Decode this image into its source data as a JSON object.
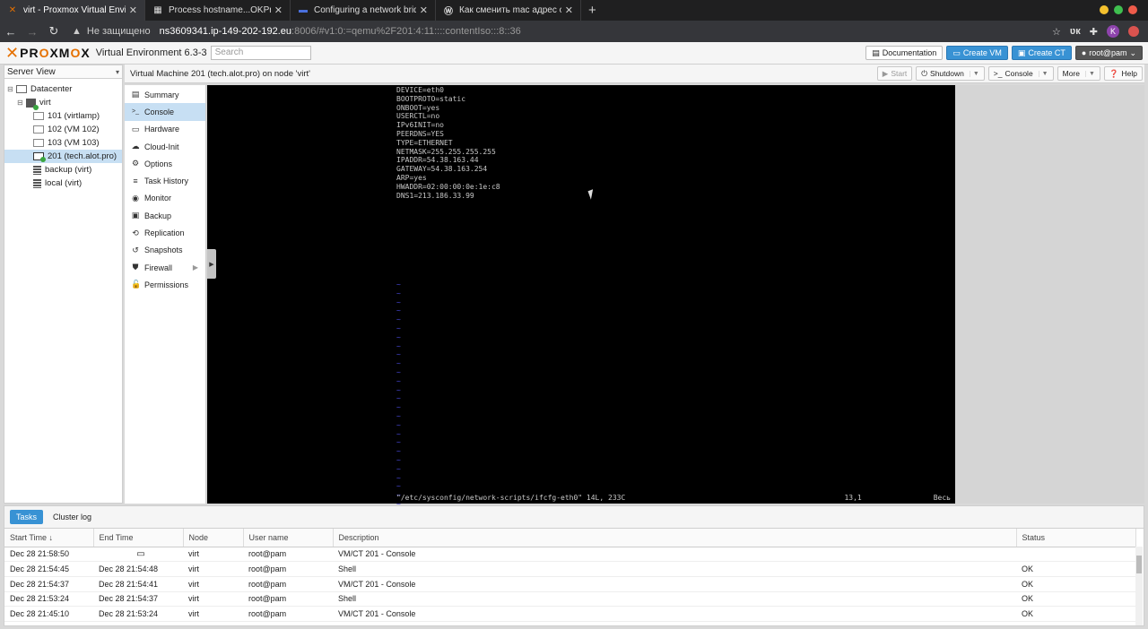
{
  "browser": {
    "tabs": [
      {
        "title": "virt - Proxmox Virtual Environ",
        "icon": "proxmox-x",
        "active": true
      },
      {
        "title": "Process hostname...OKProce",
        "icon": "page"
      },
      {
        "title": "Configuring a network bridg",
        "icon": "page"
      },
      {
        "title": "Как сменить mac адрес сете",
        "icon": "wordpress"
      }
    ],
    "new_tab": "+",
    "security_label": "Не защищено",
    "url_host": "ns3609341.ip-149-202-192.eu",
    "url_path": ":8006/#v1:0:=qemu%2F201:4:11::::contentIso:::8::36",
    "avatar_letter": "K"
  },
  "pve": {
    "logo_text": "PROXMOX",
    "version": "Virtual Environment 6.3-3",
    "search_placeholder": "Search",
    "documentation": "Documentation",
    "create_vm": "Create VM",
    "create_ct": "Create CT",
    "user": "root@pam"
  },
  "tree": {
    "view": "Server View",
    "items": [
      {
        "label": "Datacenter"
      },
      {
        "label": "virt"
      },
      {
        "label": "101 (virtlamp)"
      },
      {
        "label": "102 (VM 102)"
      },
      {
        "label": "103 (VM 103)"
      },
      {
        "label": "201 (tech.alot.pro)"
      },
      {
        "label": "backup (virt)"
      },
      {
        "label": "local (virt)"
      }
    ]
  },
  "content": {
    "title": "Virtual Machine 201 (tech.alot.pro) on node 'virt'",
    "start": "Start",
    "shutdown": "Shutdown",
    "console": "Console",
    "more": "More",
    "help": "Help"
  },
  "nav": [
    {
      "label": "Summary",
      "icon": "summary-icon",
      "glyph": "▤"
    },
    {
      "label": "Console",
      "icon": "console-icon",
      "glyph": ">_"
    },
    {
      "label": "Hardware",
      "icon": "hardware-icon",
      "glyph": "▭"
    },
    {
      "label": "Cloud-Init",
      "icon": "cloud-icon",
      "glyph": "☁"
    },
    {
      "label": "Options",
      "icon": "gear-icon",
      "glyph": "⚙"
    },
    {
      "label": "Task History",
      "icon": "task-history-icon",
      "glyph": "≡"
    },
    {
      "label": "Monitor",
      "icon": "monitor-icon",
      "glyph": "◉"
    },
    {
      "label": "Backup",
      "icon": "backup-icon",
      "glyph": "▣"
    },
    {
      "label": "Replication",
      "icon": "replication-icon",
      "glyph": "⟲"
    },
    {
      "label": "Snapshots",
      "icon": "snapshots-icon",
      "glyph": "↺"
    },
    {
      "label": "Firewall",
      "icon": "shield-icon",
      "glyph": "⛊"
    },
    {
      "label": "Permissions",
      "icon": "unlock-icon",
      "glyph": "🔓"
    }
  ],
  "terminal": {
    "lines": [
      "DEVICE=eth0",
      "BOOTPROTO=static",
      "ONBOOT=yes",
      "USERCTL=no",
      "IPv6INIT=no",
      "PEERDNS=YES",
      "TYPE=ETHERNET",
      "NETMASK=255.255.255.255",
      "IPADDR=54.38.163.44",
      "GATEWAY=54.38.163.254",
      "ARP=yes",
      "HWADDR=02:00:00:0e:1e:c8",
      "DNS1=213.186.33.99"
    ],
    "status_file": "\"/etc/sysconfig/network-scripts/ifcfg-eth0\" 14L, 233C",
    "status_pos": "13,1",
    "status_pct": "Весь"
  },
  "bottom": {
    "tabs": [
      "Tasks",
      "Cluster log"
    ],
    "columns": [
      "Start Time ↓",
      "End Time",
      "Node",
      "User name",
      "Description",
      "Status"
    ],
    "rows": [
      {
        "start": "Dec 28 21:58:50",
        "end": "",
        "node": "virt",
        "user": "root@pam",
        "desc": "VM/CT 201 - Console",
        "status": ""
      },
      {
        "start": "Dec 28 21:54:45",
        "end": "Dec 28 21:54:48",
        "node": "virt",
        "user": "root@pam",
        "desc": "Shell",
        "status": "OK"
      },
      {
        "start": "Dec 28 21:54:37",
        "end": "Dec 28 21:54:41",
        "node": "virt",
        "user": "root@pam",
        "desc": "VM/CT 201 - Console",
        "status": "OK"
      },
      {
        "start": "Dec 28 21:53:24",
        "end": "Dec 28 21:54:37",
        "node": "virt",
        "user": "root@pam",
        "desc": "Shell",
        "status": "OK"
      },
      {
        "start": "Dec 28 21:45:10",
        "end": "Dec 28 21:53:24",
        "node": "virt",
        "user": "root@pam",
        "desc": "VM/CT 201 - Console",
        "status": "OK"
      }
    ]
  }
}
